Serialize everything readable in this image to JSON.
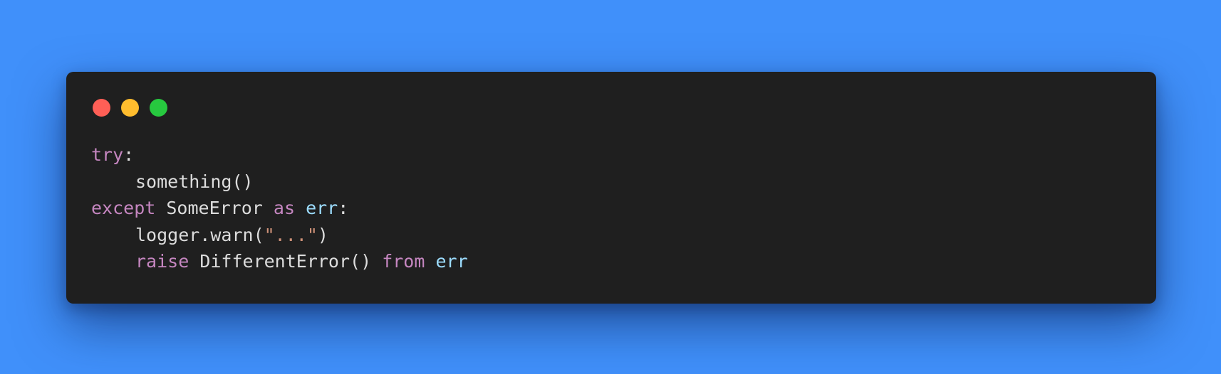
{
  "theme": {
    "background": "#4090fa",
    "window_bg": "#1f1f1f",
    "plain_text": "#dcdcdc",
    "keyword": "#c586c0",
    "variable": "#9cdcfe",
    "string": "#ce9178"
  },
  "window_controls": [
    {
      "name": "close",
      "color": "#ff5f56"
    },
    {
      "name": "minimize",
      "color": "#ffbd2e"
    },
    {
      "name": "maximize",
      "color": "#27c93f"
    }
  ],
  "code": {
    "lines": [
      {
        "indent": false,
        "tokens": [
          {
            "text": "try",
            "kind": "kw"
          },
          {
            "text": ":",
            "kind": "pl"
          }
        ]
      },
      {
        "indent": true,
        "tokens": [
          {
            "text": "something()",
            "kind": "pl"
          }
        ]
      },
      {
        "indent": false,
        "tokens": [
          {
            "text": "except",
            "kind": "kw"
          },
          {
            "text": " SomeError ",
            "kind": "pl"
          },
          {
            "text": "as",
            "kind": "kw"
          },
          {
            "text": " ",
            "kind": "pl"
          },
          {
            "text": "err",
            "kind": "vr"
          },
          {
            "text": ":",
            "kind": "pl"
          }
        ]
      },
      {
        "indent": true,
        "tokens": [
          {
            "text": "logger.warn(",
            "kind": "pl"
          },
          {
            "text": "\"...\"",
            "kind": "st"
          },
          {
            "text": ")",
            "kind": "pl"
          }
        ]
      },
      {
        "indent": true,
        "tokens": [
          {
            "text": "raise",
            "kind": "kw"
          },
          {
            "text": " DifferentError() ",
            "kind": "pl"
          },
          {
            "text": "from",
            "kind": "kw"
          },
          {
            "text": " ",
            "kind": "pl"
          },
          {
            "text": "err",
            "kind": "vr"
          }
        ]
      }
    ]
  }
}
